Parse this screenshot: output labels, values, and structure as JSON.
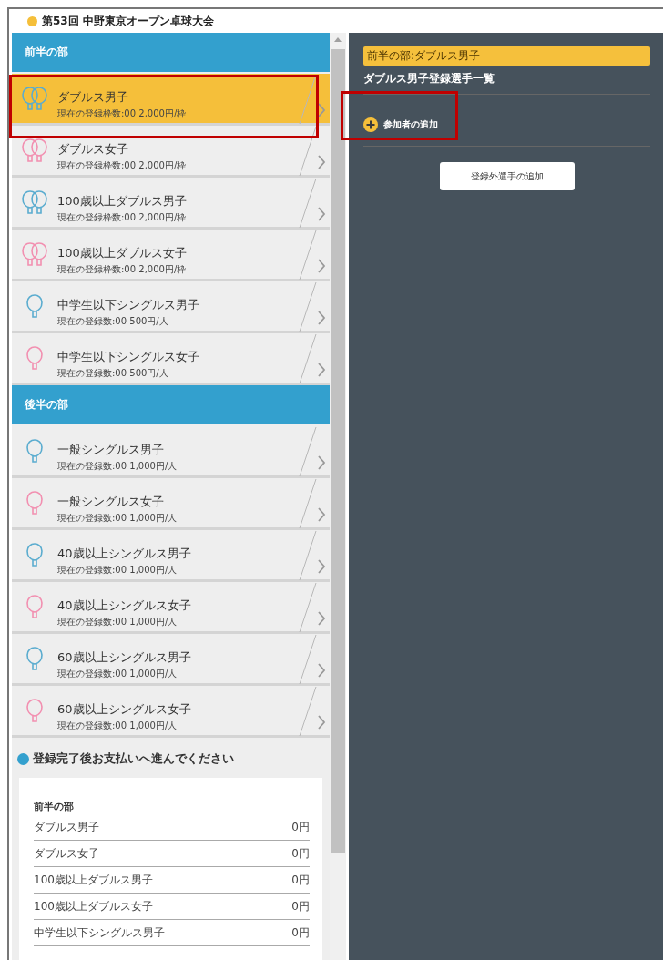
{
  "title": "第53回 中野東京オープン卓球大会",
  "sections": [
    {
      "heading": "前半の部",
      "items": [
        {
          "name": "ダブルス男子",
          "note": "現在の登録枠数:00 2,000円/枠",
          "kind": "doubles",
          "color": "#5aaccf",
          "selected": true
        },
        {
          "name": "ダブルス女子",
          "note": "現在の登録枠数:00 2,000円/枠",
          "kind": "doubles",
          "color": "#f28fb0",
          "selected": false
        },
        {
          "name": "100歳以上ダブルス男子",
          "note": "現在の登録枠数:00 2,000円/枠",
          "kind": "doubles",
          "color": "#5aaccf",
          "selected": false
        },
        {
          "name": "100歳以上ダブルス女子",
          "note": "現在の登録枠数:00 2,000円/枠",
          "kind": "doubles",
          "color": "#f28fb0",
          "selected": false
        },
        {
          "name": "中学生以下シングルス男子",
          "note": "現在の登録数:00 500円/人",
          "kind": "singles",
          "color": "#5aaccf",
          "selected": false
        },
        {
          "name": "中学生以下シングルス女子",
          "note": "現在の登録数:00 500円/人",
          "kind": "singles",
          "color": "#f28fb0",
          "selected": false
        }
      ]
    },
    {
      "heading": "後半の部",
      "items": [
        {
          "name": "一般シングルス男子",
          "note": "現在の登録数:00 1,000円/人",
          "kind": "singles",
          "color": "#5aaccf",
          "selected": false
        },
        {
          "name": "一般シングルス女子",
          "note": "現在の登録数:00 1,000円/人",
          "kind": "singles",
          "color": "#f28fb0",
          "selected": false
        },
        {
          "name": "40歳以上シングルス男子",
          "note": "現在の登録数:00 1,000円/人",
          "kind": "singles",
          "color": "#5aaccf",
          "selected": false
        },
        {
          "name": "40歳以上シングルス女子",
          "note": "現在の登録数:00 1,000円/人",
          "kind": "singles",
          "color": "#f28fb0",
          "selected": false
        },
        {
          "name": "60歳以上シングルス男子",
          "note": "現在の登録数:00 1,000円/人",
          "kind": "singles",
          "color": "#5aaccf",
          "selected": false
        },
        {
          "name": "60歳以上シングルス女子",
          "note": "現在の登録数:00 1,000円/人",
          "kind": "singles",
          "color": "#f28fb0",
          "selected": false
        }
      ]
    }
  ],
  "summary": {
    "heading": "登録完了後お支払いへ進んでください",
    "groups": [
      {
        "heading": "前半の部",
        "rows": [
          {
            "name": "ダブルス男子",
            "amount": "0円"
          },
          {
            "name": "ダブルス女子",
            "amount": "0円"
          },
          {
            "name": "100歳以上ダブルス男子",
            "amount": "0円"
          },
          {
            "name": "100歳以上ダブルス女子",
            "amount": "0円"
          },
          {
            "name": "中学生以下シングルス男子",
            "amount": "0円"
          }
        ]
      }
    ]
  },
  "detail": {
    "breadcrumb": "前半の部:ダブルス男子",
    "title": "ダブルス男子登録選手一覧",
    "add_participant": "参加者の追加",
    "add_unregistered": "登録外選手の追加"
  }
}
